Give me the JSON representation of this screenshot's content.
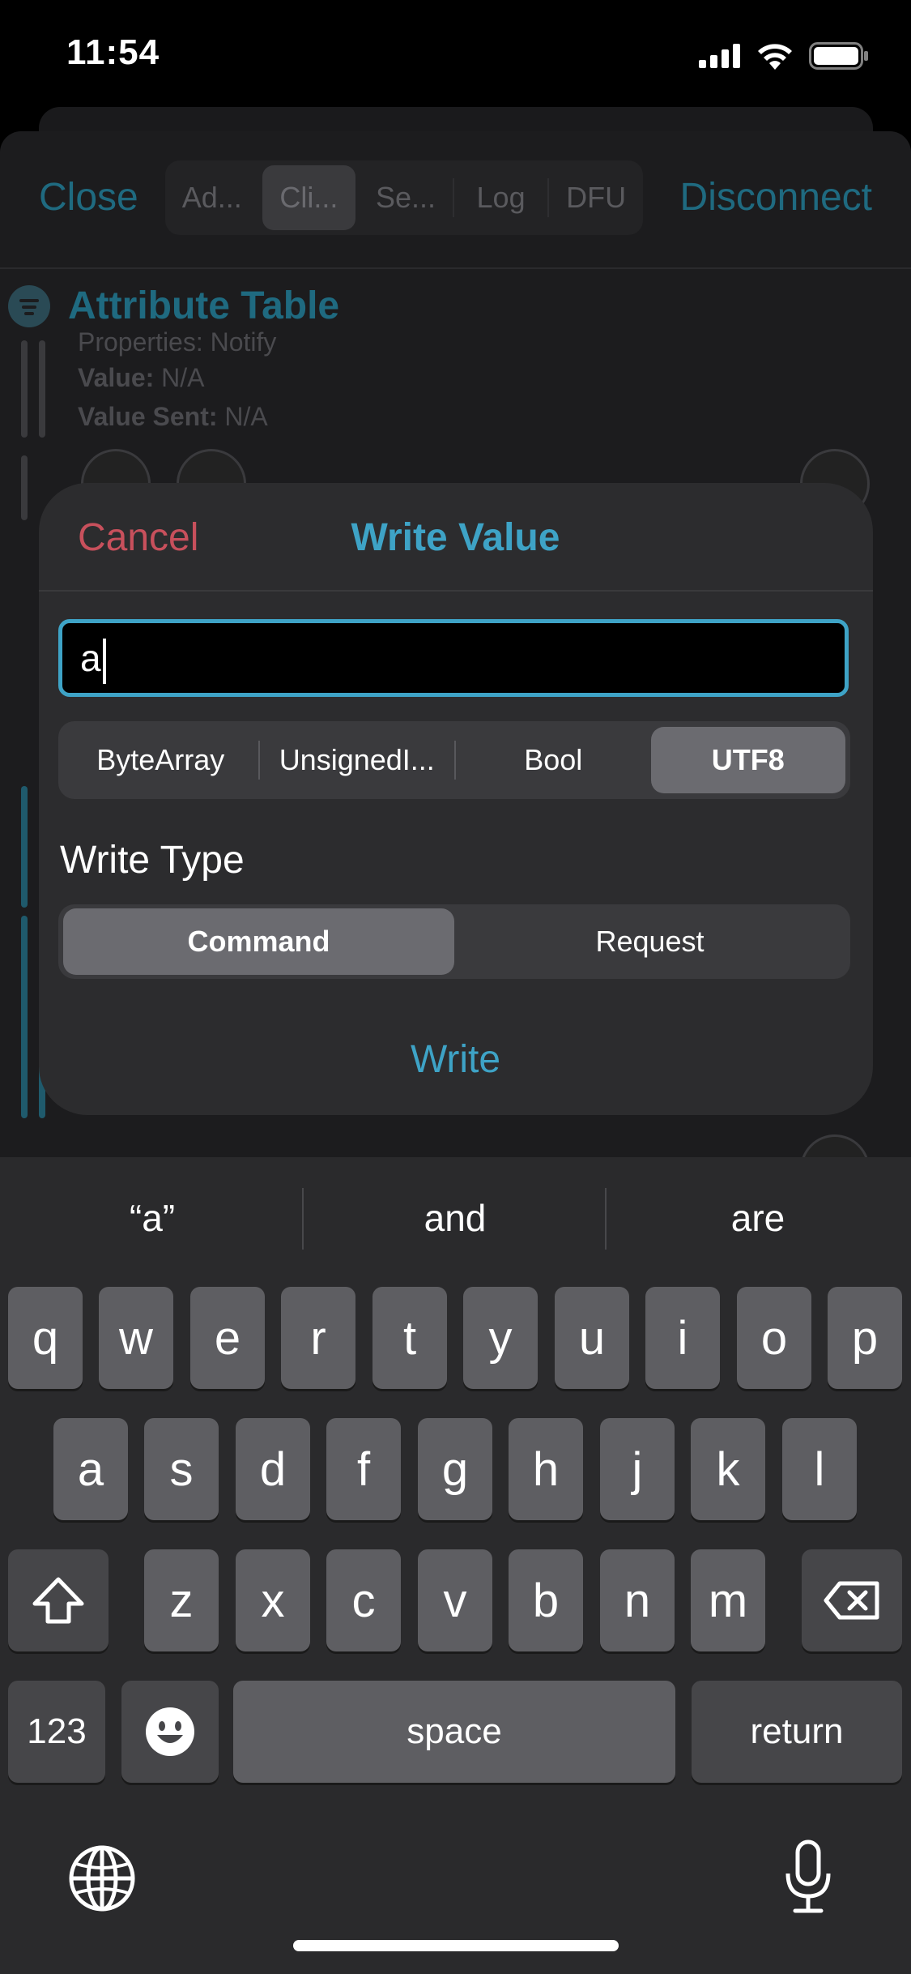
{
  "status_bar": {
    "time": "11:54"
  },
  "nav": {
    "close": "Close",
    "disconnect": "Disconnect",
    "tabs": [
      {
        "label": "Ad..."
      },
      {
        "label": "Cli..."
      },
      {
        "label": "Se..."
      },
      {
        "label": "Log"
      },
      {
        "label": "DFU"
      }
    ]
  },
  "attribute_table": {
    "title": "Attribute Table",
    "properties": "Properties: Notify",
    "value_label": "Value:",
    "value": "N/A",
    "value_sent_label": "Value Sent:",
    "value_sent": "N/A"
  },
  "dialog": {
    "cancel": "Cancel",
    "title": "Write Value",
    "input_value": "a",
    "formats": [
      "ByteArray",
      "UnsignedI...",
      "Bool",
      "UTF8"
    ],
    "selected_format": "UTF8",
    "write_type_label": "Write Type",
    "write_types": [
      "Command",
      "Request"
    ],
    "selected_write_type": "Command",
    "write_button": "Write"
  },
  "keyboard": {
    "suggestions": [
      "“a”",
      "and",
      "are"
    ],
    "row1": [
      "q",
      "w",
      "e",
      "r",
      "t",
      "y",
      "u",
      "i",
      "o",
      "p"
    ],
    "row2": [
      "a",
      "s",
      "d",
      "f",
      "g",
      "h",
      "j",
      "k",
      "l"
    ],
    "row3": [
      "z",
      "x",
      "c",
      "v",
      "b",
      "n",
      "m"
    ],
    "numbers_key": "123",
    "space_key": "space",
    "return_key": "return"
  },
  "colors": {
    "accent": "#3ea3c6",
    "cancel": "#c8505c",
    "dim_accent": "#1f6a80"
  }
}
